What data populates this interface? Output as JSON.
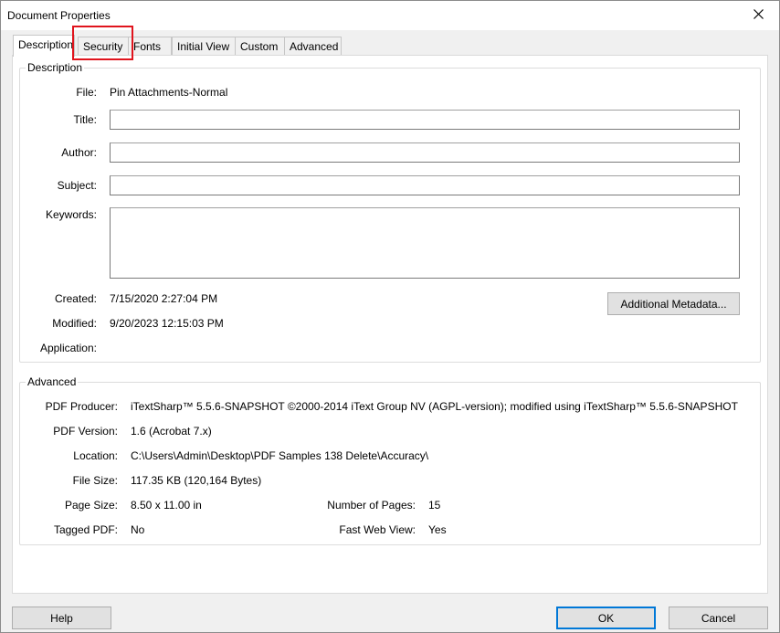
{
  "window": {
    "title": "Document Properties",
    "close_icon": "close-icon"
  },
  "tabs": [
    {
      "label": "Description",
      "active": true
    },
    {
      "label": "Security",
      "active": false
    },
    {
      "label": "Fonts",
      "active": false
    },
    {
      "label": "Initial View",
      "active": false
    },
    {
      "label": "Custom",
      "active": false
    },
    {
      "label": "Advanced",
      "active": false
    }
  ],
  "description": {
    "group_title": "Description",
    "file_label": "File:",
    "file_value": "Pin Attachments-Normal",
    "title_label": "Title:",
    "title_value": "",
    "author_label": "Author:",
    "author_value": "",
    "subject_label": "Subject:",
    "subject_value": "",
    "keywords_label": "Keywords:",
    "keywords_value": "",
    "created_label": "Created:",
    "created_value": "7/15/2020 2:27:04 PM",
    "modified_label": "Modified:",
    "modified_value": "9/20/2023 12:15:03 PM",
    "application_label": "Application:",
    "application_value": "",
    "metadata_button": "Additional Metadata..."
  },
  "advanced": {
    "group_title": "Advanced",
    "producer_label": "PDF Producer:",
    "producer_value": "iTextSharp™ 5.5.6-SNAPSHOT ©2000-2014 iText Group NV (AGPL-version); modified using iTextSharp™ 5.5.6-SNAPSHOT",
    "version_label": "PDF Version:",
    "version_value": "1.6 (Acrobat 7.x)",
    "location_label": "Location:",
    "location_value": "C:\\Users\\Admin\\Desktop\\PDF Samples 138 Delete\\Accuracy\\",
    "filesize_label": "File Size:",
    "filesize_value": "117.35 KB (120,164 Bytes)",
    "pagesize_label": "Page Size:",
    "pagesize_value": "8.50 x 11.00 in",
    "pages_label": "Number of Pages:",
    "pages_value": "15",
    "tagged_label": "Tagged PDF:",
    "tagged_value": "No",
    "fastweb_label": "Fast Web View:",
    "fastweb_value": "Yes"
  },
  "footer": {
    "help_label": "Help",
    "ok_label": "OK",
    "cancel_label": "Cancel"
  },
  "colors": {
    "highlight": "#e0141d",
    "default_button_border": "#0078d7"
  }
}
